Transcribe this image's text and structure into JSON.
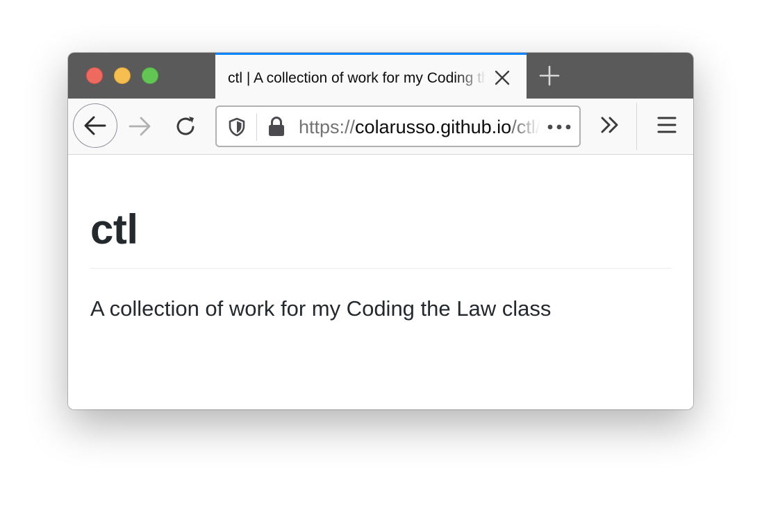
{
  "browser": {
    "tab": {
      "title": "ctl | A collection of work for my Coding the Law class"
    },
    "urlbar": {
      "scheme": "https://",
      "host": "colarusso.github.io",
      "path": "/ctl/"
    }
  },
  "page": {
    "title": "ctl",
    "description": "A collection of work for my Coding the Law class"
  },
  "colors": {
    "tabstrip": "#5b5a5a",
    "active_tab_highlight": "#0a84ff",
    "toolbar": "#f9f9fa",
    "heading_text": "#24292e"
  },
  "icons": {
    "window_controls": [
      "close-dot",
      "minimize-dot",
      "maximize-dot"
    ],
    "tab": [
      "close-icon",
      "plus-icon"
    ],
    "navbar": [
      "back-arrow-icon",
      "forward-arrow-icon",
      "reload-icon",
      "shield-icon",
      "lock-icon",
      "more-dots-icon",
      "overflow-chevrons-icon",
      "hamburger-menu-icon"
    ]
  }
}
